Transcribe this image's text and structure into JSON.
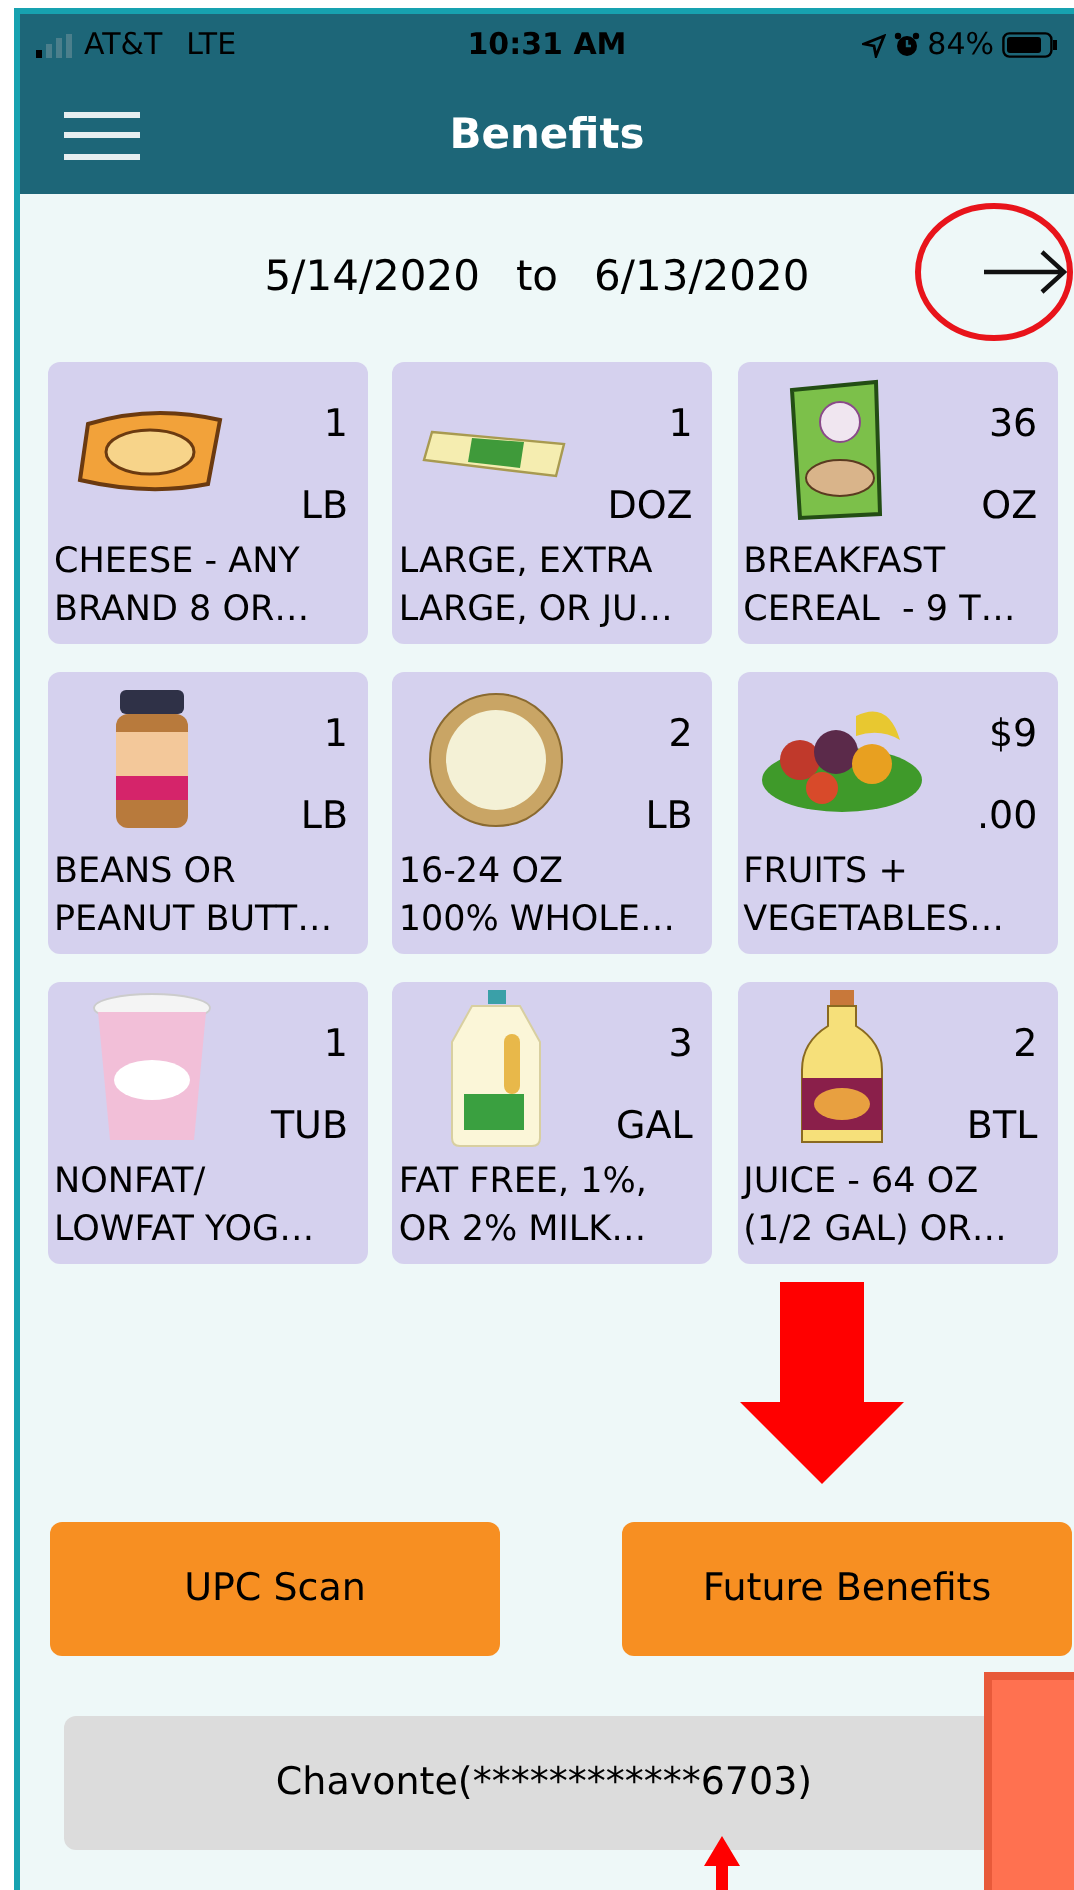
{
  "status_bar": {
    "carrier": "AT&T",
    "network": "LTE",
    "time": "10:31 AM",
    "battery": "84%"
  },
  "header": {
    "title": "Benefits"
  },
  "date_range": {
    "start": "5/14/2020",
    "separator": "to",
    "end": "6/13/2020"
  },
  "benefits": [
    {
      "kind": "cheese",
      "quantity": "1",
      "unit": "LB",
      "description": "CHEESE - ANY\nBRAND 8 OR…"
    },
    {
      "kind": "eggs",
      "quantity": "1",
      "unit": "DOZ",
      "description": "LARGE, EXTRA\nLARGE, OR JU…"
    },
    {
      "kind": "cereal",
      "quantity": "36",
      "unit": "OZ",
      "description": "BREAKFAST\nCEREAL  - 9 T…"
    },
    {
      "kind": "peanut_butter",
      "quantity": "1",
      "unit": "LB",
      "description": "BEANS OR\nPEANUT BUTT…"
    },
    {
      "kind": "tortillas",
      "quantity": "2",
      "unit": "LB",
      "description": "16-24 OZ\n100% WHOLE…"
    },
    {
      "kind": "produce",
      "quantity": "$9",
      "unit": ".00",
      "description": "FRUITS +\nVEGETABLES…"
    },
    {
      "kind": "yogurt",
      "quantity": "1",
      "unit": "TUB",
      "description": "NONFAT/\nLOWFAT YOG…"
    },
    {
      "kind": "milk",
      "quantity": "3",
      "unit": "GAL",
      "description": "FAT FREE, 1%,\nOR 2% MILK…"
    },
    {
      "kind": "juice",
      "quantity": "2",
      "unit": "BTL",
      "description": "JUICE - 64 OZ\n(1/2 GAL) OR…"
    }
  ],
  "buttons": [
    "UPC Scan",
    "Future Benefits"
  ],
  "account": "Chavonte(************6703)"
}
